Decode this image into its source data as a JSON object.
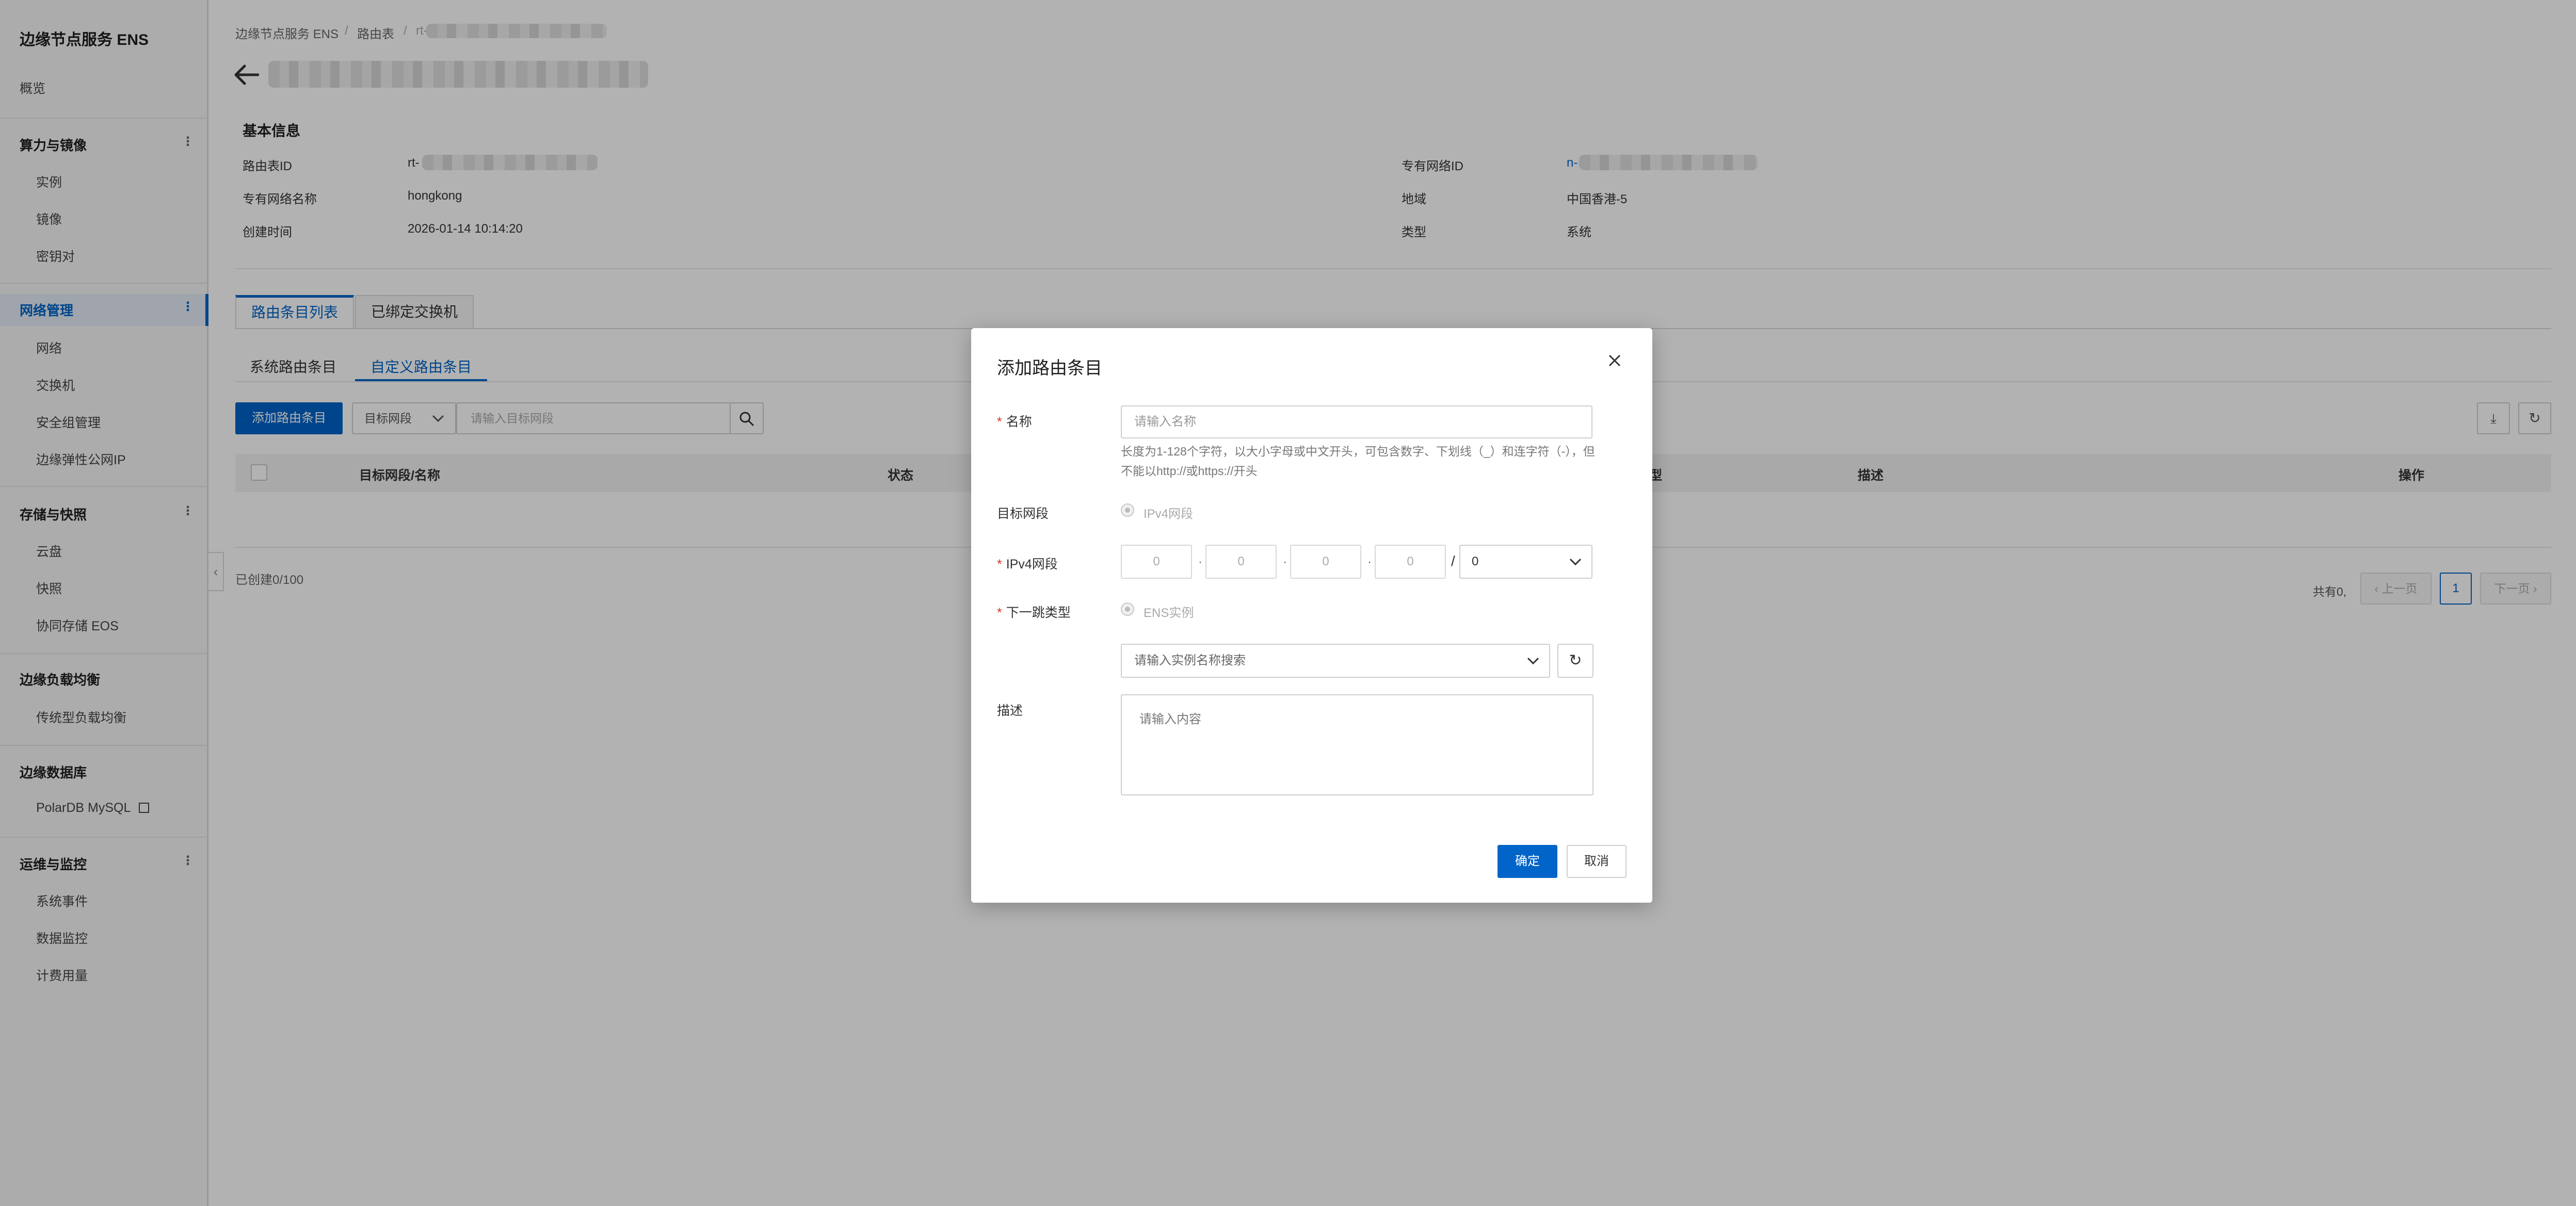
{
  "sidebar": {
    "title": "边缘节点服务 ENS",
    "overview": "概览",
    "sections": [
      {
        "label": "算力与镜像",
        "items": [
          "实例",
          "镜像",
          "密钥对"
        ]
      },
      {
        "label": "网络管理",
        "items": [
          "网络",
          "交换机",
          "安全组管理",
          "边缘弹性公网IP"
        ]
      },
      {
        "label": "存储与快照",
        "items": [
          "云盘",
          "快照",
          "协同存储 EOS"
        ]
      },
      {
        "label": "边缘负载均衡",
        "items": [
          "传统型负载均衡"
        ]
      },
      {
        "label": "边缘数据库",
        "items": [
          "PolarDB MySQL"
        ]
      },
      {
        "label": "运维与监控",
        "items": [
          "系统事件",
          "数据监控",
          "计费用量"
        ]
      }
    ]
  },
  "breadcrumb": {
    "root": "边缘节点服务 ENS",
    "sep": "/",
    "level2": "路由表",
    "level3": "rt-"
  },
  "basic_info": {
    "heading": "基本信息",
    "route_table_id_label": "路由表ID",
    "route_table_id_value": "rt-",
    "vpc_name_label": "专有网络名称",
    "vpc_name_value": "hongkong",
    "created_label": "创建时间",
    "created_value": "2026-01-14 10:14:20",
    "vpc_id_label": "专有网络ID",
    "vpc_id_value": "n-",
    "region_label": "地域",
    "region_value": "中国香港-5",
    "type_label": "类型",
    "type_value": "系统"
  },
  "tabs": [
    "路由条目列表",
    "已绑定交换机"
  ],
  "subtabs": [
    "系统路由条目",
    "自定义路由条目"
  ],
  "toolbar": {
    "add_button": "添加路由条目",
    "filter_select": "目标网段",
    "search_placeholder": "请输入目标网段"
  },
  "table": {
    "headers": [
      "目标网段/名称",
      "状态",
      "型",
      "描述",
      "操作"
    ],
    "created_count": "已创建0/100"
  },
  "pagination": {
    "total": "共有0,",
    "prev": "上一页",
    "page": "1",
    "next": "下一页"
  },
  "dialog": {
    "title": "添加路由条目",
    "name_label": "名称",
    "name_placeholder": "请输入名称",
    "name_help": "长度为1-128个字符，以大小字母或中文开头，可包含数字、下划线（_）和连字符（-），但不能以http://或https://开头",
    "target_label": "目标网段",
    "target_option": "IPv4网段",
    "ipv4_label": "IPv4网段",
    "octets": [
      "0",
      "0",
      "0",
      "0"
    ],
    "mask": "0",
    "nexthop_label": "下一跳类型",
    "nexthop_option": "ENS实例",
    "instance_placeholder": "请输入实例名称搜索",
    "desc_label": "描述",
    "desc_placeholder": "请输入内容",
    "ok": "确定",
    "cancel": "取消"
  },
  "colors": {
    "accent": "#0064c8",
    "required": "#d93026"
  }
}
